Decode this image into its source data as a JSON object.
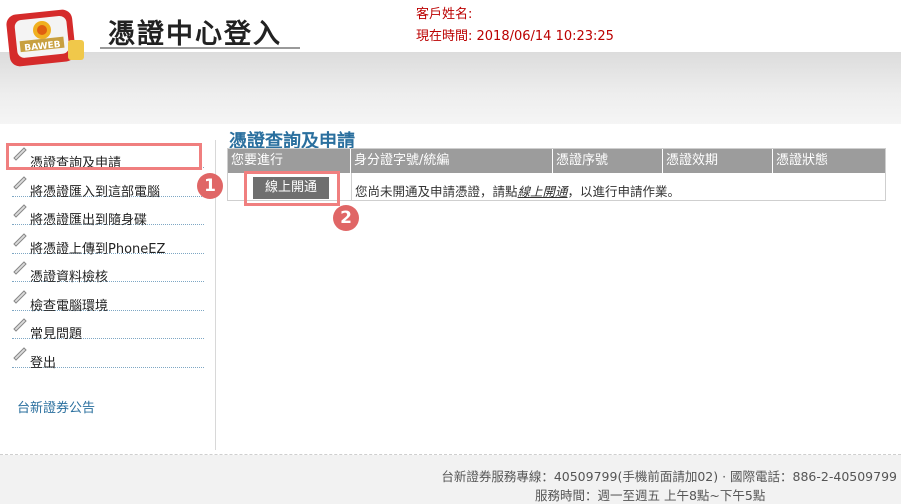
{
  "header": {
    "title": "憑證中心登入",
    "customer_label": "客戶姓名:",
    "time_label": "現在時間: 2018/06/14 10:23:25",
    "logo_text": "BAWEB"
  },
  "sidebar": {
    "items": [
      {
        "label": "憑證查詢及申請"
      },
      {
        "label": "將憑證匯入到這部電腦"
      },
      {
        "label": "將憑證匯出到隨身碟"
      },
      {
        "label": "將憑證上傳到PhoneEZ"
      },
      {
        "label": "憑證資料檢核"
      },
      {
        "label": "檢查電腦環境"
      },
      {
        "label": "常見問題"
      },
      {
        "label": "登出"
      }
    ],
    "notice": "台新證券公告"
  },
  "main": {
    "title": "憑證查詢及申請",
    "columns": [
      "您要進行",
      "身分證字號/統編",
      "憑證序號",
      "憑證效期",
      "憑證狀態"
    ],
    "row": {
      "button": "線上開通",
      "message_prefix": "您尚未開通及申請憑證，請點",
      "message_link": "線上開通",
      "message_suffix": "，以進行申請作業。"
    }
  },
  "annotations": {
    "badge1": "1",
    "badge2": "2"
  },
  "footer": {
    "line1": "台新證券服務專線：40509799(手機前面請加02) · 國際電話：886-2-40509799",
    "line2": "服務時間：週一至週五 上午8點~下午5點"
  }
}
